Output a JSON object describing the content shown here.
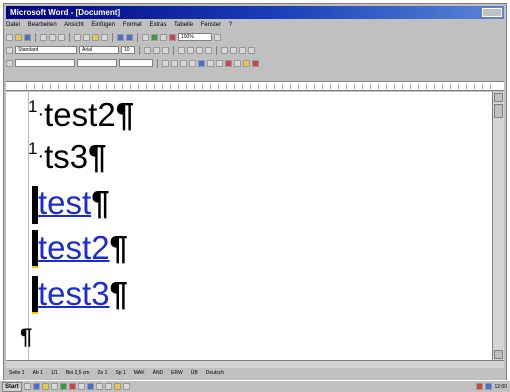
{
  "window": {
    "title": "Microsoft Word - [Document]"
  },
  "menu": [
    "Datei",
    "Bearbeiten",
    "Ansicht",
    "Einfügen",
    "Format",
    "Extras",
    "Tabelle",
    "Fenster",
    "?"
  ],
  "toolbar": {
    "style_value": "Standard",
    "font_value": "Arial",
    "size_value": "10",
    "zoom_value": "100%"
  },
  "document": {
    "lines": [
      {
        "num": "1",
        "text": "test2",
        "mark": "¶"
      },
      {
        "num": "1",
        "text": "ts3",
        "mark": "¶"
      },
      {
        "dot": "·",
        "text": "test",
        "mark": "¶"
      },
      {
        "dot": "·",
        "text": "test2",
        "mark": "¶"
      },
      {
        "dot": "·",
        "text": "test3",
        "mark": "¶"
      },
      {
        "mark": "¶"
      }
    ]
  },
  "status": [
    "Seite 1",
    "Ab 1",
    "1/1",
    "Bei 2,5 cm",
    "Ze 1",
    "Sp 1",
    "MAK",
    "ÄND",
    "ERW",
    "ÜB",
    "Deutsch"
  ],
  "taskbar": {
    "start": "Start",
    "clock": "12:00"
  },
  "colors": {
    "link": "#1c2cd4",
    "title_start": "#00007b",
    "highlight": "#e6d000"
  }
}
